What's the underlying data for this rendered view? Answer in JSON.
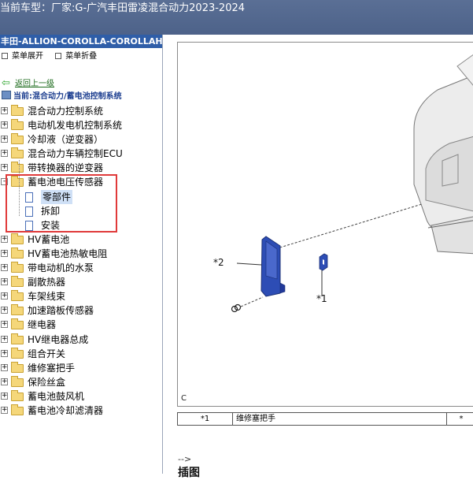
{
  "title": {
    "prefix": "当前车型：",
    "vehicle": "厂家:G-广汽丰田雷凌混合动力2023-2024"
  },
  "sidebar": {
    "header": "丰田-ALLION-COROLLA-COROLLAHYBRID",
    "toolbar": {
      "expand_label": "菜单展开",
      "collapse_label": "菜单折叠"
    },
    "back_label": "返回上一级",
    "current_path": "当前:混合动力/蓄电池控制系统",
    "tree": [
      {
        "label": "混合动力控制系统",
        "toggle": "+"
      },
      {
        "label": "电动机发电机控制系统",
        "toggle": "+"
      },
      {
        "label": "冷却液（逆变器）",
        "toggle": "+"
      },
      {
        "label": "混合动力车辆控制ECU",
        "toggle": "+"
      },
      {
        "label": "带转换器的逆变器",
        "toggle": "+"
      },
      {
        "label": "蓄电池电压传感器",
        "toggle": "-"
      },
      {
        "label": "HV蓄电池",
        "toggle": "+"
      },
      {
        "label": "HV蓄电池热敏电阻",
        "toggle": "+"
      },
      {
        "label": "带电动机的水泵",
        "toggle": "+"
      },
      {
        "label": "副散热器",
        "toggle": "+"
      },
      {
        "label": "车架线束",
        "toggle": "+"
      },
      {
        "label": "加速踏板传感器",
        "toggle": "+"
      },
      {
        "label": "继电器",
        "toggle": "+"
      },
      {
        "label": "HV继电器总成",
        "toggle": "+"
      },
      {
        "label": "组合开关",
        "toggle": "+"
      },
      {
        "label": "维修塞把手",
        "toggle": "+"
      },
      {
        "label": "保险丝盒",
        "toggle": "+"
      },
      {
        "label": "蓄电池鼓风机",
        "toggle": "+"
      },
      {
        "label": "蓄电池冷却滤清器",
        "toggle": "+"
      }
    ],
    "children": [
      {
        "label": "零部件"
      },
      {
        "label": "拆卸"
      },
      {
        "label": "安装"
      }
    ]
  },
  "main": {
    "figure": {
      "letter": "C",
      "callout_1": "*1",
      "callout_2": "*2"
    },
    "legend": {
      "num": "*1",
      "desc": "维修塞把手",
      "extra": "*"
    },
    "comment": "-->",
    "section_heading": "插图"
  },
  "colors": {
    "titlebar": "#5a6f95",
    "sidebar_header": "#2f5ea8",
    "highlight_box": "#e03a3a",
    "part_blue": "#2d4db5"
  }
}
